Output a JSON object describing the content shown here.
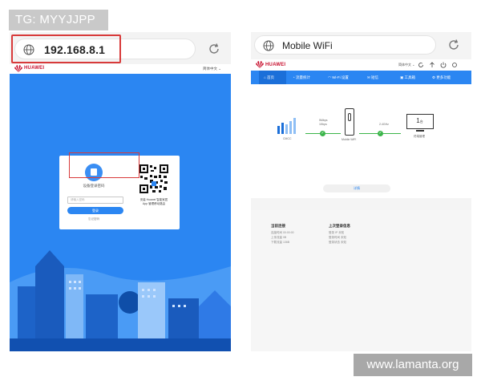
{
  "watermarks": {
    "top_left": "TG: MYYJJPP",
    "bottom_right": "www.lamanta.org"
  },
  "left_phone": {
    "address": "192.168.8.1",
    "brand": "HUAWEI",
    "language": "简体中文 ⌄",
    "login": {
      "title": "设备登录密码",
      "password_placeholder": "请输入密码",
      "button_label": "登录",
      "forgot_label": "忘记密码"
    },
    "qr_caption_line1": "安装 Huawei 智能家居",
    "qr_caption_line2": "App 管理移动路由"
  },
  "right_phone": {
    "address": "Mobile WiFi",
    "brand": "HUAWEI",
    "language": "简体中文 ⌄",
    "nav": [
      {
        "label": "首页"
      },
      {
        "label": "流量统计"
      },
      {
        "label": "Wi-Fi 设置"
      },
      {
        "label": "短信"
      },
      {
        "label": "工具箱"
      },
      {
        "label": "更多功能"
      }
    ],
    "status": {
      "network_label": "CMCC",
      "signal_left_label": "5Mbps",
      "signal_left_label2": "1Kbps",
      "device_label": "Mobile WiFi",
      "wifi_band": "2.4GHz",
      "client_count": "1",
      "client_unit": "台",
      "client_label": "终端管理",
      "details_button": "详情"
    },
    "footer": {
      "current_title": "当前连接",
      "current_rows": [
        "连接时间  00:00:00",
        "上传流量  0B",
        "下载流量  136B"
      ],
      "last_title": "上次登录信息",
      "last_rows": [
        "登录 IP  未知",
        "登录时间  未知",
        "登录状态  未知"
      ]
    }
  }
}
